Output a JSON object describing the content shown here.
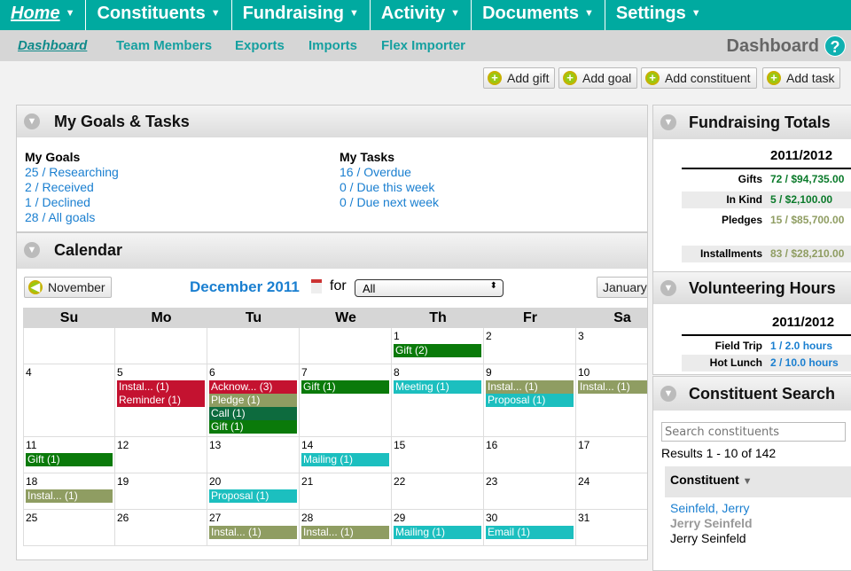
{
  "nav": {
    "items": [
      {
        "label": "Home"
      },
      {
        "label": "Constituents"
      },
      {
        "label": "Fundraising"
      },
      {
        "label": "Activity"
      },
      {
        "label": "Documents"
      },
      {
        "label": "Settings"
      }
    ]
  },
  "subnav": {
    "items": [
      "Dashboard",
      "Team Members",
      "Exports",
      "Imports",
      "Flex Importer"
    ],
    "title": "Dashboard",
    "help": "?"
  },
  "toolbar": {
    "add_gift": "Add gift",
    "add_goal": "Add goal",
    "add_constituent": "Add constituent",
    "add_task": "Add task"
  },
  "goals": {
    "title": "My Goals & Tasks",
    "goals_heading": "My Goals",
    "goals": [
      "25 / Researching",
      "2 / Received",
      "1 / Declined",
      "28 / All goals"
    ],
    "tasks_heading": "My Tasks",
    "tasks": [
      "16 / Overdue",
      "0 / Due this week",
      "0 / Due next week"
    ]
  },
  "calendar": {
    "title": "Calendar",
    "prev": "November",
    "month": "December 2011",
    "for": "for",
    "filter": "All",
    "next": "January",
    "days": [
      "Su",
      "Mo",
      "Tu",
      "We",
      "Th",
      "Fr",
      "Sa"
    ],
    "colors": {
      "red": "#c41230",
      "olive": "#8f9d62",
      "green": "#0a7a0a",
      "teal": "#1cbfbf",
      "call": "#0d6b3e"
    },
    "weeks": [
      [
        {
          "d": ""
        },
        {
          "d": ""
        },
        {
          "d": ""
        },
        {
          "d": ""
        },
        {
          "d": "1",
          "ev": [
            [
              "Gift (2)",
              "green"
            ]
          ]
        },
        {
          "d": "2"
        },
        {
          "d": "3"
        }
      ],
      [
        {
          "d": "4"
        },
        {
          "d": "5",
          "ev": [
            [
              "Instal... (1)",
              "red"
            ],
            [
              "Reminder (1)",
              "red"
            ]
          ]
        },
        {
          "d": "6",
          "ev": [
            [
              "Acknow... (3)",
              "red"
            ],
            [
              "Pledge (1)",
              "olive"
            ],
            [
              "Call (1)",
              "call"
            ],
            [
              "Gift (1)",
              "green"
            ]
          ]
        },
        {
          "d": "7",
          "ev": [
            [
              "Gift (1)",
              "green"
            ]
          ]
        },
        {
          "d": "8",
          "ev": [
            [
              "Meeting (1)",
              "teal"
            ]
          ]
        },
        {
          "d": "9",
          "ev": [
            [
              "Instal... (1)",
              "olive"
            ],
            [
              "Proposal (1)",
              "teal"
            ]
          ]
        },
        {
          "d": "10",
          "ev": [
            [
              "Instal... (1)",
              "olive"
            ]
          ]
        }
      ],
      [
        {
          "d": "11",
          "ev": [
            [
              "Gift (1)",
              "green"
            ]
          ]
        },
        {
          "d": "12"
        },
        {
          "d": "13"
        },
        {
          "d": "14",
          "ev": [
            [
              "Mailing (1)",
              "teal"
            ]
          ]
        },
        {
          "d": "15"
        },
        {
          "d": "16"
        },
        {
          "d": "17"
        }
      ],
      [
        {
          "d": "18",
          "ev": [
            [
              "Instal... (1)",
              "olive"
            ]
          ]
        },
        {
          "d": "19"
        },
        {
          "d": "20",
          "ev": [
            [
              "Proposal (1)",
              "teal"
            ]
          ]
        },
        {
          "d": "21"
        },
        {
          "d": "22"
        },
        {
          "d": "23"
        },
        {
          "d": "24"
        }
      ],
      [
        {
          "d": "25"
        },
        {
          "d": "26"
        },
        {
          "d": "27",
          "ev": [
            [
              "Instal... (1)",
              "olive"
            ]
          ]
        },
        {
          "d": "28",
          "ev": [
            [
              "Instal... (1)",
              "olive"
            ]
          ]
        },
        {
          "d": "29",
          "ev": [
            [
              "Mailing (1)",
              "teal"
            ]
          ]
        },
        {
          "d": "30",
          "ev": [
            [
              "Email (1)",
              "teal"
            ]
          ]
        },
        {
          "d": "31"
        }
      ]
    ]
  },
  "fundraising": {
    "title": "Fundraising Totals",
    "year": "2011/2012",
    "rows": [
      {
        "k": "Gifts",
        "v": "72 / $94,735.00",
        "c": "#0a7a2a"
      },
      {
        "k": "In Kind",
        "v": "5 / $2,100.00",
        "c": "#0a7a2a"
      },
      {
        "k": "Pledges",
        "v": "15 / $85,700.00",
        "c": "#8f9d62"
      },
      {
        "k": "Installments",
        "v": "83 / $28,210.00",
        "c": "#8f9d62"
      }
    ]
  },
  "volunteering": {
    "title": "Volunteering Hours",
    "year": "2011/2012",
    "rows": [
      {
        "k": "Field Trip",
        "v": "1 / 2.0 hours"
      },
      {
        "k": "Hot Lunch",
        "v": "2 / 10.0 hours"
      }
    ]
  },
  "search": {
    "title": "Constituent Search",
    "placeholder": "Search constituents",
    "results": "Results 1 - 10 of 142",
    "column": "Constituent",
    "result_name": "Seinfeld, Jerry",
    "result_alt": "Jerry Seinfeld",
    "result_plain": "Jerry Seinfeld"
  }
}
